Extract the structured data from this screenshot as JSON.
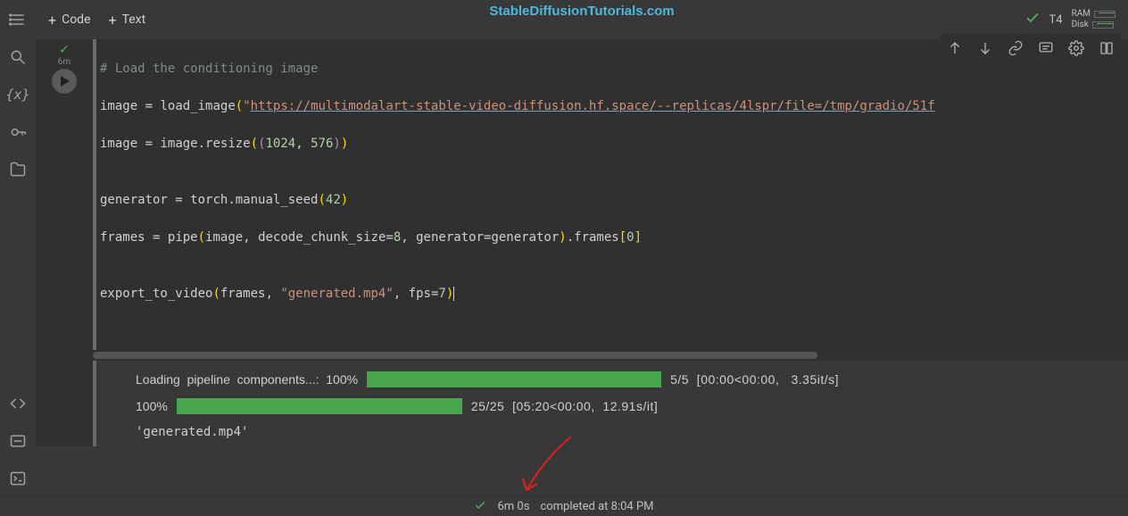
{
  "watermark": "StableDiffusionTutorials.com",
  "toolbar": {
    "code_btn": "Code",
    "text_btn": "Text",
    "runtime": "T4",
    "resources": {
      "ram": "RAM",
      "disk": "Disk"
    }
  },
  "cell": {
    "gutter_time": "6m",
    "code": {
      "comment": "# Load the conditioning image",
      "l1_var": "image",
      "l1_func": "load_image",
      "l1_url": "https://multimodalart-stable-video-diffusion.hf.space/--replicas/4lspr/file=/tmp/gradio/51f",
      "l2_var": "image",
      "l2_expr_a": "image.resize",
      "l2_n1": "1024",
      "l2_n2": "576",
      "l3_var": "generator",
      "l3_expr": "torch.manual_seed",
      "l3_n": "42",
      "l4_var": "frames",
      "l4_func": "pipe",
      "l4_arg1": "image",
      "l4_arg2a": "decode_chunk_size",
      "l4_arg2b": "8",
      "l4_arg3a": "generator",
      "l4_arg3b": "generator",
      "l4_tail": ".frames",
      "l4_idx": "0",
      "l5_func": "export_to_video",
      "l5_arg1": "frames",
      "l5_str": "\"generated.mp4\"",
      "l5_arg3a": "fps",
      "l5_arg3b": "7"
    }
  },
  "output": {
    "line1_label": "Loading  pipeline  components...:  100%",
    "line1_stats": "5/5  [00:00<00:00,   3.35it/s]",
    "line2_label": "100%",
    "line2_stats": "25/25  [05:20<00:00,  12.91s/it]",
    "file": "'generated.mp4'"
  },
  "status_bar": {
    "duration": "6m 0s",
    "completed": "completed at 8:04 PM"
  }
}
